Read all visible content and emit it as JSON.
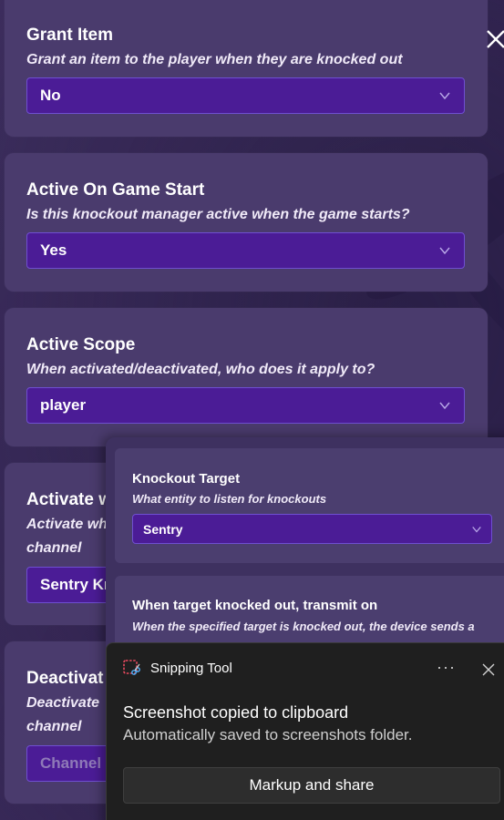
{
  "settings": [
    {
      "title": "Grant Item",
      "description": "Grant an item to the player when they are knocked out",
      "value": "No"
    },
    {
      "title": "Active On Game Start",
      "description": "Is this knockout manager active when the game starts?",
      "value": "Yes"
    },
    {
      "title": "Active Scope",
      "description": "When activated/deactivated, who does it apply to?",
      "value": "player"
    },
    {
      "title": "Activate w",
      "description_line1": "Activate wh",
      "description_line2": "channel",
      "value": "Sentry Kn"
    },
    {
      "title": "Deactivat",
      "description_line1": "Deactivate",
      "description_line2": "channel",
      "placeholder": "Channel n"
    }
  ],
  "overlay_panel": {
    "knockout_target": {
      "title": "Knockout Target",
      "description": "What entity to listen for knockouts",
      "value": "Sentry"
    },
    "transmit": {
      "title": "When target knocked out, transmit on",
      "description": "When the specified target is knocked out, the device sends a"
    }
  },
  "toast": {
    "app_name": "Snipping Tool",
    "more_label": "···",
    "message_title": "Screenshot copied to clipboard",
    "message_subtitle": "Automatically saved to screenshots folder.",
    "action_label": "Markup and share"
  },
  "icons": {
    "dialog_close": "close-icon",
    "dropdown": "chevron-down-icon",
    "app": "snipping-tool-icon",
    "toast_close": "close-icon",
    "more": "more-options-icon"
  },
  "colors": {
    "background": "#3a2a5c",
    "card": "#4a3b6d",
    "select": "#4b1c96",
    "select_border": "#6f4fd0",
    "toast_bg": "#1f1f1f"
  }
}
